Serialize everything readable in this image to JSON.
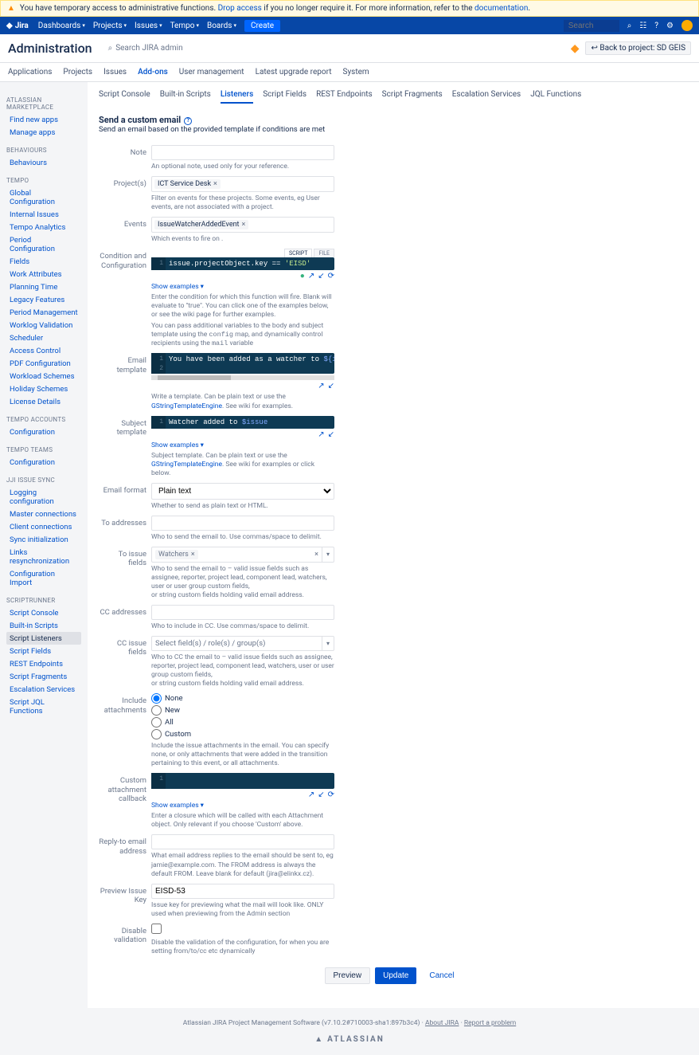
{
  "banner": {
    "text1": "You have temporary access to administrative functions. ",
    "drop": "Drop access",
    "text2": " if you no longer require it. For more information, refer to the ",
    "doc": "documentation",
    "period": "."
  },
  "nav": {
    "brand": "Jira",
    "items": [
      "Dashboards",
      "Projects",
      "Issues",
      "Tempo",
      "Boards"
    ],
    "create": "Create",
    "search_ph": "Search"
  },
  "adminhdr": {
    "title": "Administration",
    "search": "Search JIRA admin",
    "back": "Back to project: SD GEIS"
  },
  "tabs": [
    "Applications",
    "Projects",
    "Issues",
    "Add-ons",
    "User management",
    "Latest upgrade report",
    "System"
  ],
  "tabs_active": 3,
  "sidebar": [
    {
      "section": "ATLASSIAN MARKETPLACE",
      "items": [
        "Find new apps",
        "Manage apps"
      ]
    },
    {
      "section": "BEHAVIOURS",
      "items": [
        "Behaviours"
      ]
    },
    {
      "section": "TEMPO",
      "items": [
        "Global Configuration",
        "Internal Issues",
        "Tempo Analytics",
        "Period Configuration",
        "Fields",
        "Work Attributes",
        "Planning Time",
        "Legacy Features",
        "Period Management",
        "Worklog Validation",
        "Scheduler",
        "Access Control",
        "PDF Configuration",
        "Workload Schemes",
        "Holiday Schemes",
        "License Details"
      ]
    },
    {
      "section": "TEMPO ACCOUNTS",
      "items": [
        "Configuration"
      ]
    },
    {
      "section": "TEMPO TEAMS",
      "items": [
        "Configuration"
      ]
    },
    {
      "section": "JJI ISSUE SYNC",
      "items": [
        "Logging configuration",
        "Master connections",
        "Client connections",
        "Sync initialization",
        "Links resynchronization",
        "Configuration Import"
      ]
    },
    {
      "section": "SCRIPTRUNNER",
      "items": [
        "Script Console",
        "Built-in Scripts",
        "Script Listeners",
        "Script Fields",
        "REST Endpoints",
        "Script Fragments",
        "Escalation Services",
        "Script JQL Functions"
      ]
    }
  ],
  "sidebar_sel": "Script Listeners",
  "subtabs": [
    "Script Console",
    "Built-in Scripts",
    "Listeners",
    "Script Fields",
    "REST Endpoints",
    "Script Fragments",
    "Escalation Services",
    "JQL Functions"
  ],
  "subtabs_active": 2,
  "form": {
    "title": "Send a custom email",
    "desc": "Send an email based on the provided template if conditions are met",
    "note_lbl": "Note",
    "note_help": "An optional note, used only for your reference.",
    "projects_lbl": "Project(s)",
    "projects_chip": "ICT Service Desk",
    "projects_help": "Filter on events for these projects. Some events, eg User events, are not associated with a project.",
    "events_lbl": "Events",
    "events_chip": "IssueWatcherAddedEvent",
    "events_help": "Which events to fire on .",
    "cond_lbl": "Condition and Configuration",
    "code_tabs": [
      "SCRIPT",
      "FILE"
    ],
    "cond_code": "issue.projectObject.key == 'EISD'",
    "showex": "Show examples",
    "cond_help1": "Enter the condition for which this function will fire. Blank will evaluate to \"true\". You can click one of the examples below, or see the wiki page for further examples.",
    "cond_help2_a": "You can pass additional variables to the body and subject template using the ",
    "cond_help2_b": "config",
    "cond_help2_c": " map, and dynamically control recipients using the ",
    "cond_help2_d": "mail",
    "cond_help2_e": " variable",
    "emailtpl_lbl": "Email template",
    "emailtpl_code": "You have been added as a watcher to ${issue.key} ${issue.summary}",
    "emailtpl_help_a": "Write a template. Can be plain text or use the ",
    "emailtpl_help_b": "GStringTemplateEngine",
    "emailtpl_help_c": ". See wiki for examples.",
    "subjtpl_lbl": "Subject template",
    "subjtpl_code": "Watcher added to $issue",
    "subjtpl_help_a": "Subject template. Can be plain text or use the ",
    "subjtpl_help_b": "GStringTemplateEngine",
    "subjtpl_help_c": ". See wiki for examples or click below.",
    "emailfmt_lbl": "Email format",
    "emailfmt_val": "Plain text",
    "emailfmt_help": "Whether to send as plain text or HTML.",
    "toaddr_lbl": "To addresses",
    "toaddr_help": "Who to send the email to. Use commas/space to delimit.",
    "toissue_lbl": "To issue fields",
    "toissue_chip": "Watchers",
    "toissue_help": "Who to send the email to – valid issue fields such as assignee, reporter, project lead, component lead, watchers, user or user group custom fields,\nor string custom fields holding valid email address.",
    "ccaddr_lbl": "CC addresses",
    "ccaddr_help": "Who to include in CC. Use commas/space to delimit.",
    "ccissue_lbl": "CC issue fields",
    "ccissue_ph": "Select field(s) / role(s) / group(s)",
    "ccissue_help": "Who to CC the email to – valid issue fields such as assignee, reporter, project lead, component lead, watchers, user or user group custom fields,\nor string custom fields holding valid email address.",
    "incatt_lbl": "Include attachments",
    "incatt_opts": [
      "None",
      "New",
      "All",
      "Custom"
    ],
    "incatt_sel": 0,
    "incatt_help": "Include the issue attachments in the email. You can specify none, or only attachments that were added in the transition pertaining to this event, or all attachments.",
    "custcb_lbl": "Custom attachment callback",
    "custcb_help": "Enter a closure which will be called with each Attachment object. Only relevant if you choose 'Custom' above.",
    "replyto_lbl": "Reply-to email address",
    "replyto_help": "What email address replies to the email should be sent to, eg jamie@example.com. The FROM address is always the default FROM. Leave blank for default (jira@elinkx.cz).",
    "preview_lbl": "Preview Issue Key",
    "preview_val": "EISD-53",
    "preview_help": "Issue key for previewing what the mail will look like. ONLY used when previewing from the Admin section",
    "disval_lbl": "Disable validation",
    "disval_help": "Disable the validation of the configuration, for when you are setting from/to/cc etc dynamically",
    "btn_preview": "Preview",
    "btn_update": "Update",
    "btn_cancel": "Cancel"
  },
  "footer": {
    "line": "Atlassian JIRA Project Management Software (v7.10.2#710003-sha1:897b3c4)",
    "about": "About JIRA",
    "report": "Report a problem",
    "brand": "ATLASSIAN"
  }
}
